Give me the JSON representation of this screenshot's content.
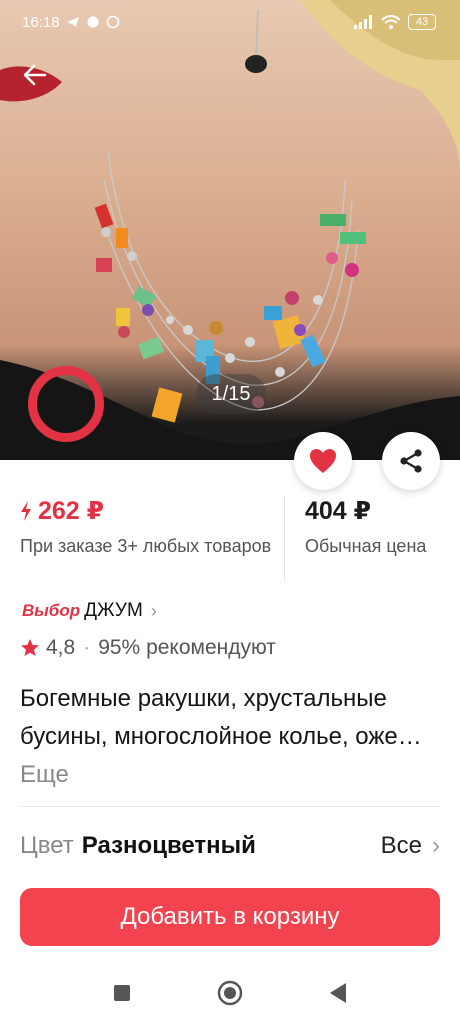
{
  "status_bar": {
    "time": "16:18",
    "battery": "43",
    "icons": [
      "telegram-icon",
      "chat-icon",
      "whatsapp-icon",
      "signal-icon",
      "wifi-icon",
      "battery-icon"
    ]
  },
  "gallery": {
    "pager": "1/15"
  },
  "pricing": {
    "promo_price": "262 ₽",
    "promo_note": "При заказе 3+ любых товаров",
    "regular_price": "404 ₽",
    "regular_note": "Обычная цена"
  },
  "seller": {
    "brand": "Выбор",
    "name": "ДЖУМ"
  },
  "rating": {
    "score": "4,8",
    "recommend": "95% рекомендуют"
  },
  "product": {
    "title": "Богемные ракушки, хрустальные бусины, многослойное колье, оже…",
    "more": "Еще"
  },
  "color": {
    "label": "Цвет",
    "value": "Разноцветный",
    "all": "Все"
  },
  "actions": {
    "add_to_cart": "Добавить в корзину"
  },
  "colors": {
    "accent": "#e23244",
    "button": "#f2434f"
  }
}
